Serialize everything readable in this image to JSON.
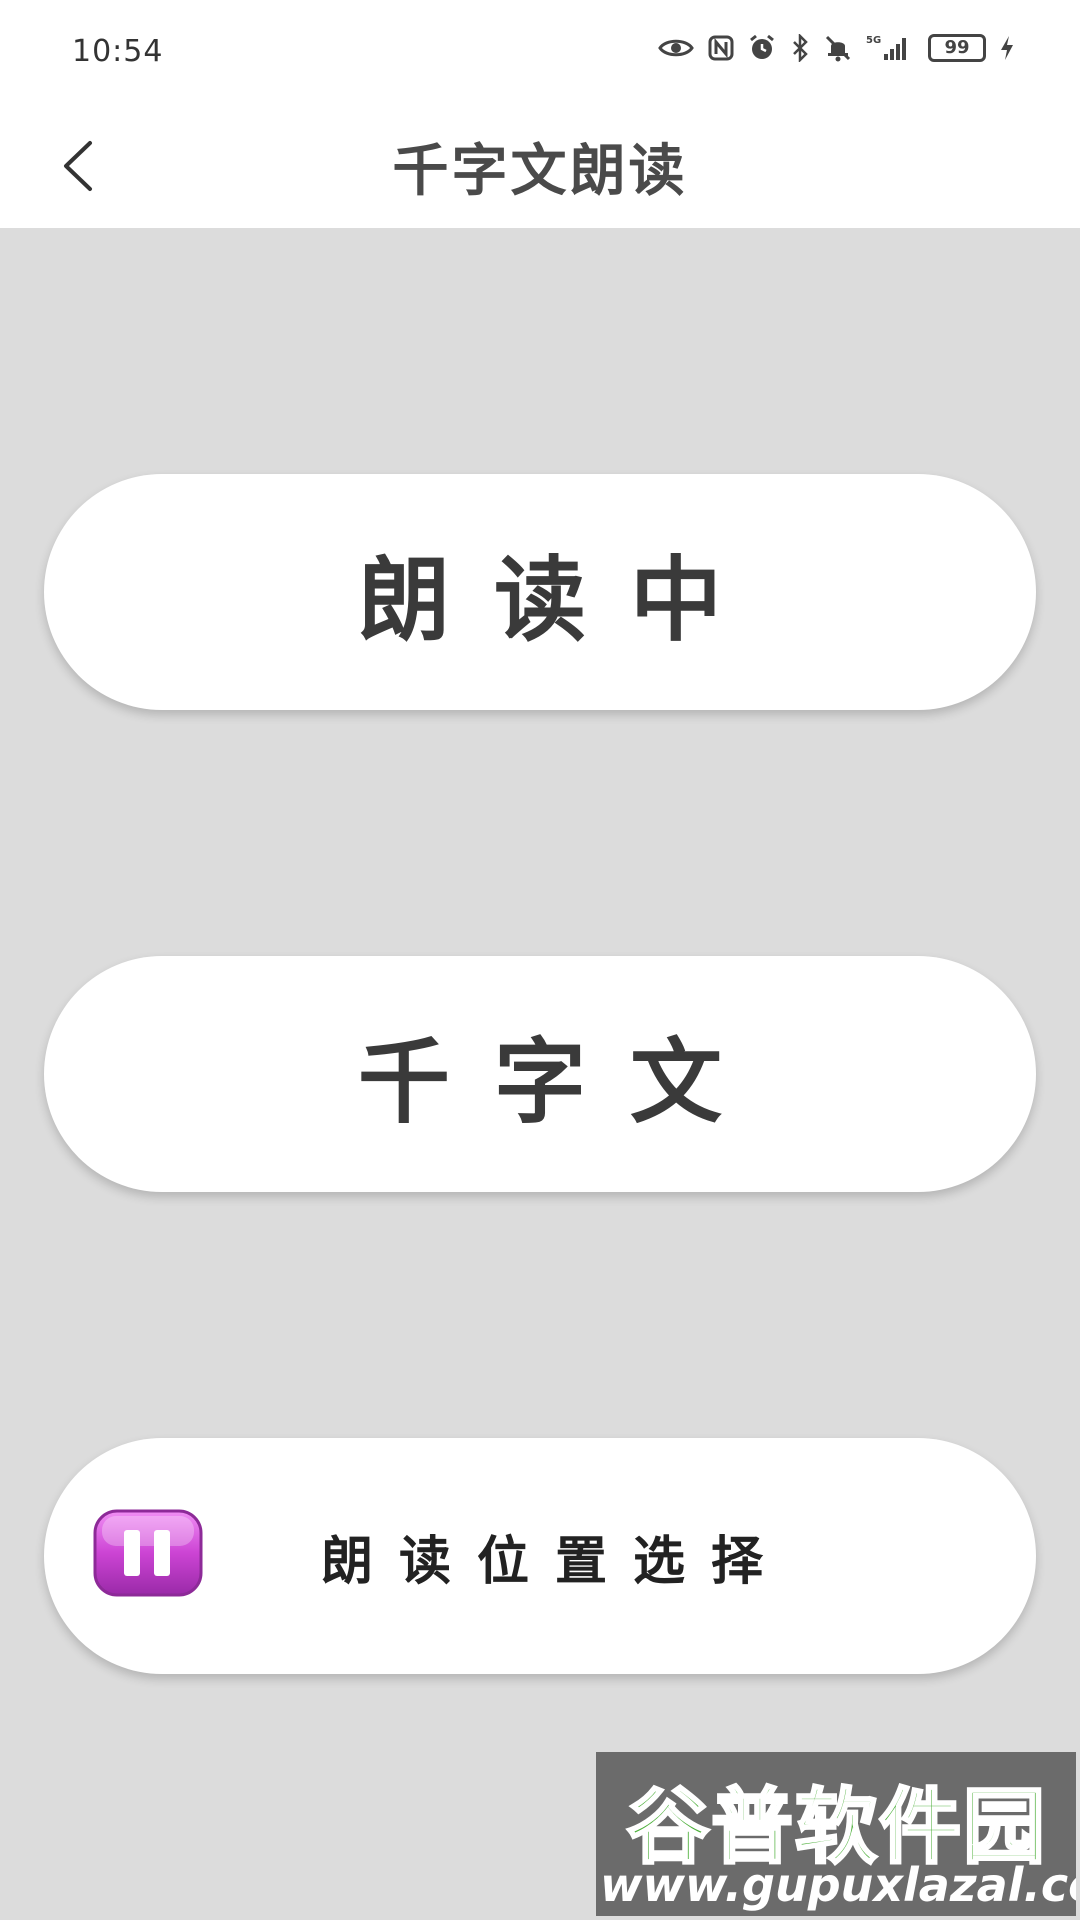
{
  "status_bar": {
    "time": "10:54",
    "network": "5G",
    "battery": "99",
    "icons": [
      "eye-icon",
      "nfc-icon",
      "alarm-icon",
      "bluetooth-icon",
      "mute-bell-icon",
      "signal-icon",
      "charging-icon"
    ]
  },
  "app_bar": {
    "title": "千字文朗读",
    "back_icon": "chevron-left-icon"
  },
  "buttons": {
    "reading": "朗读中",
    "qianziwen": "千字文",
    "position": "朗读位置选择",
    "position_icon": "pause-icon"
  },
  "colors": {
    "background": "#dcdcdc",
    "card": "#ffffff",
    "pause_icon": "#cc44d4"
  },
  "watermark": {
    "logo": "谷普软件园",
    "url": "www.gupuxlazal.com"
  }
}
